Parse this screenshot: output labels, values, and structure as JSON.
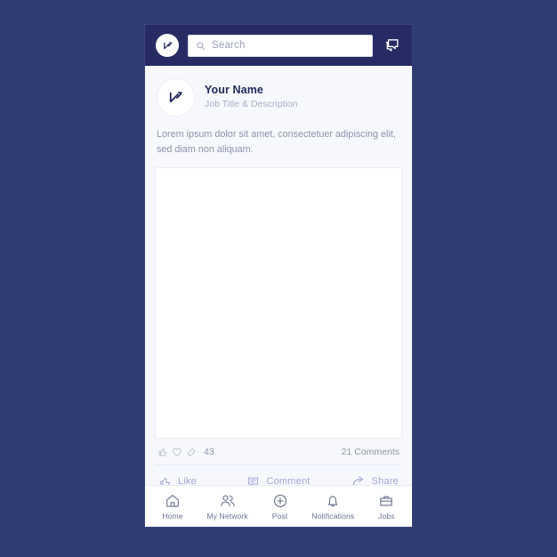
{
  "theme": {
    "page_background": "#2f3c72",
    "header_background": "#262c63",
    "card_background": "#f7f8fd",
    "accent_text": "#202a5c",
    "muted_text": "#9095ad",
    "action_text": "#a6a7d6",
    "nav_text": "#6b7290"
  },
  "header": {
    "brand_icon": "brand-logo-icon",
    "search": {
      "icon": "search-icon",
      "placeholder": "Search",
      "value": ""
    },
    "messages_icon": "messages-icon"
  },
  "post": {
    "avatar_icon": "brand-logo-icon",
    "author_name": "Your Name",
    "author_subtitle": "Job Title & Description",
    "body_text": "Lorem ipsum dolor sit amet, consectetuer adipiscing elit, sed diam non aliquam.",
    "image_placeholder": "post-image",
    "reactions": {
      "icons": [
        "thumbs-up-icon",
        "heart-icon",
        "clap-icon"
      ],
      "count": "43",
      "comments": "21 Comments"
    },
    "actions": [
      {
        "label": "Like",
        "icon": "thumbs-up-icon"
      },
      {
        "label": "Comment",
        "icon": "comment-icon"
      },
      {
        "label": "Share",
        "icon": "share-icon"
      }
    ]
  },
  "bottom_nav": {
    "items": [
      {
        "label": "Home",
        "icon": "home-icon"
      },
      {
        "label": "My Network",
        "icon": "people-icon"
      },
      {
        "label": "Post",
        "icon": "plus-circle-icon"
      },
      {
        "label": "Notifications",
        "icon": "bell-icon"
      },
      {
        "label": "Jobs",
        "icon": "briefcase-icon"
      }
    ]
  }
}
